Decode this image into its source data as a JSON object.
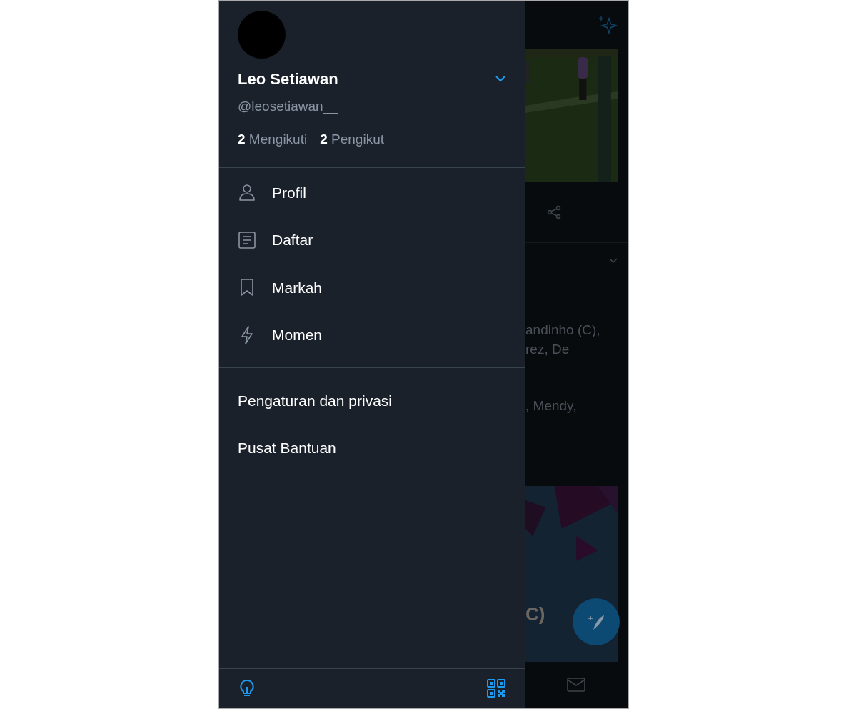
{
  "drawer": {
    "user": {
      "name": "Leo Setiawan",
      "handle": "@leosetiawan__",
      "following_count": "2",
      "following_label": "Mengikuti",
      "followers_count": "2",
      "followers_label": "Pengikut"
    },
    "menu": [
      {
        "kind": "person",
        "label": "Profil"
      },
      {
        "kind": "list",
        "label": "Daftar"
      },
      {
        "kind": "bookmark",
        "label": "Markah"
      },
      {
        "kind": "bolt",
        "label": "Momen"
      }
    ],
    "links": [
      "Pengaturan dan privasi",
      "Pusat Bantuan"
    ]
  },
  "background": {
    "text_lines": [
      "andinho (C),",
      "rez, De",
      ", Mendy,"
    ],
    "picture_caption": "C)"
  }
}
